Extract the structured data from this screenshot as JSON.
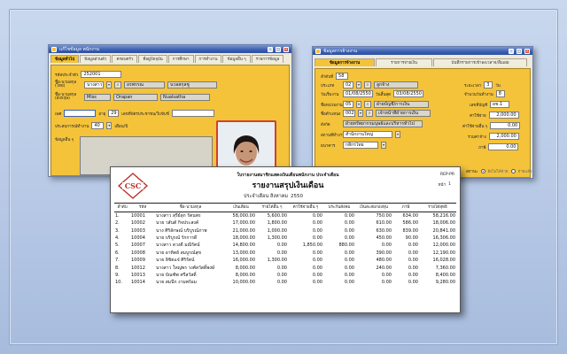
{
  "employee_window": {
    "title": "แก้ไขข้อมูล  พนักงาน",
    "tabs": [
      "ข้อมูลทั่วไป",
      "ข้อมูลส่วนตัว",
      "ครอบครัว",
      "ที่อยู่ปัจจุบัน",
      "การศึกษา",
      "การทำงาน",
      "ข้อมูลอื่น ๆ",
      "รายการข้อมูล"
    ],
    "code_label": "รหัสประจำตัว",
    "code_value": "252001",
    "name_th_label": "ชื่อ-นามสกุล (ไทย)",
    "name_th_prefix": "นางสาว",
    "name_th_first": "อรพรรณ",
    "name_th_last": "นวลสกุลชู",
    "name_en_label": "ชื่อ-นามสกุล (อังกฤษ)",
    "name_en_prefix": "Miss",
    "name_en_first": "Orapan",
    "name_en_last": "Nualsatha",
    "gender_label": "เพศ",
    "age_label": "อายุ",
    "age_value": "29",
    "id_card_label": "เลขที่บัตรประชาชน/ใบขับขี่",
    "exp_label": "ประสบการณ์ทำงาน",
    "exp_value": "40",
    "exp_unit": "เดือน/ปี",
    "notes_label": "ข้อมูลอื่น ๆ"
  },
  "payroll_window": {
    "title": "ข้อมูลการจ้างงาน",
    "tabs": [
      "ข้อมูลการจ้างงาน",
      "รายการจ่ายเงิน",
      "บันทึกรายการเข้าลงเวลาจ/ลืมเผย"
    ],
    "order_label": "ลำดับที่",
    "order_value": "58",
    "type_label": "ประเภท",
    "type_code": "02",
    "type_name": "ลูกจ้าง",
    "period_label": "ระยะเวลา",
    "period_value": "3",
    "period_unit": "วัน",
    "start_label": "วันเริ่มงาน",
    "start_value": "01/08/2550",
    "end_label": "วันสิ้นสุด",
    "end_value": "03/08/2550",
    "work_days_label": "จำนวนวันทำงาน",
    "work_days_value": "8",
    "position_label": "ชื่อหน่วยงาน",
    "position_code": "05",
    "position_name": "ฝ่ายบัญชี/การเงิน",
    "level_label": "เลขที่บัญชี",
    "level_value": "ผช.1",
    "dept_label": "ชื่อตำแหน่ง",
    "dept_code": "002",
    "dept_name": "เจ้าหน้าที่ฝ่ายการเงิน",
    "wage_label": "ค่าใช้จ่าย",
    "wage_value": "2,000.00",
    "area_label": "สังกัด",
    "area_value": "ฝ่ายทรัพยากรมนุษย์และบริหารทั่วไป",
    "allow_label": "ค่าใช้จ่ายอื่น ๆ",
    "allow_value": "0.00",
    "place_label": "สถานที่ทำงาน",
    "place_value": "สำนักงานใหญ่",
    "total_label": "รวมค่าจ้าง",
    "total_value": "2,000.00",
    "bank_label": "ธนาคาร",
    "bank_value": "กสิกรไทย",
    "tax_label": "ภาษี",
    "tax_value": "0.00",
    "status_label": "สถานะ",
    "status_opt1": "ยังไม่ได้จ่าย",
    "status_opt2": "จ่ายแล้ว"
  },
  "report": {
    "logo_text": "CSC",
    "company": "ใบรายงานสมาชิกแสดงเงินเดือนพนักงาน ประจำเดือน",
    "title": "รายงานสรุปเงินเดือน",
    "month_label": "ประจำเดือน  สิงหาคม",
    "year": "2550",
    "page_label": "หน้า",
    "page_value": "1",
    "code": "REP-PR",
    "columns": [
      "ลำดับ",
      "รหัส",
      "ชื่อ-นามสกุล",
      "เงินเดือน",
      "รายได้อื่น ๆ",
      "ค่าใช้จ่ายอื่น ๆ",
      "ประกันสังคม",
      "เงินสะสมกองทุน",
      "ภาษี",
      "รายได้สุทธิ"
    ],
    "rows": [
      [
        "1.",
        "10001",
        "นางสาว สุรีย์ลุก   รัตนพร",
        "58,000.00",
        "5,600.00",
        "0.00",
        "0.00",
        "750.00",
        "634.00",
        "58,216.00"
      ],
      [
        "2.",
        "10002",
        "นาย วสันต์   กิจประสงค์",
        "17,000.00",
        "1,800.00",
        "0.00",
        "0.00",
        "610.00",
        "586.00",
        "18,006.00"
      ],
      [
        "3.",
        "10003",
        "นาง ศิริลักษณ์   บริบูรณ์ภาพ",
        "21,000.00",
        "1,000.00",
        "0.00",
        "0.00",
        "630.00",
        "839.00",
        "20,841.00"
      ],
      [
        "4.",
        "10004",
        "นาย บริบูรณ์   รักการดี",
        "18,000.00",
        "1,300.00",
        "0.00",
        "0.00",
        "450.00",
        "90.00",
        "16,306.00"
      ],
      [
        "5.",
        "10007",
        "นางสาว ดวงดี   มณีรัตน์",
        "14,800.00",
        "0.00",
        "1,850.00",
        "880.00",
        "0.00",
        "0.00",
        "12,000.00"
      ],
      [
        "6.",
        "10008",
        "นาย อาทิตย์   สมบูรณ์สุข",
        "13,000.00",
        "0.00",
        "0.00",
        "0.00",
        "390.00",
        "0.00",
        "12,190.00"
      ],
      [
        "7.",
        "10009",
        "นาย ลิขิตแจ๋   ศิริรัตน์",
        "16,000.00",
        "1,300.00",
        "0.00",
        "0.00",
        "480.00",
        "0.00",
        "16,028.00"
      ],
      [
        "8.",
        "10012",
        "นางสาว ใหญ่พร   วงศ์สวัสดิ์พงษ์",
        "8,000.00",
        "0.00",
        "0.00",
        "0.00",
        "240.00",
        "0.00",
        "7,360.00"
      ],
      [
        "9.",
        "10013",
        "นาย บัณฑิต   ศรีสวัสดิ์",
        "8,000.00",
        "0.00",
        "0.00",
        "0.00",
        "0.00",
        "0.00",
        "8,400.00"
      ],
      [
        "10.",
        "10014",
        "นาย สมนึก   งามพร้อม",
        "10,000.00",
        "0.00",
        "0.00",
        "0.00",
        "0.00",
        "0.00",
        "9,280.00"
      ]
    ]
  }
}
